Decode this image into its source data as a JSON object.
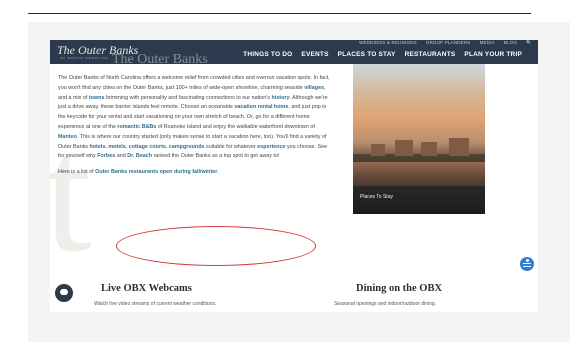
{
  "header": {
    "logo_text": "The Outer Banks",
    "logo_tagline": "OF NORTH CAROLINA",
    "utility_links": [
      "WEDDINGS & REUNIONS",
      "GROUP PLANNERS",
      "MEDIA",
      "BLOG",
      "🔍"
    ],
    "nav_items": [
      "THINGS TO DO",
      "EVENTS",
      "PLACES TO STAY",
      "RESTAURANTS",
      "PLAN YOUR TRIP"
    ]
  },
  "faded_heading": "The Outer Banks",
  "intro": {
    "p1": [
      {
        "t": "The Outer Banks of North Carolina offers a welcome relief from crowded cities and overrun vacation spots. In fact, you won't find any cities on the Outer Banks, just 100+ miles of wide-open shoreline, charming seaside "
      },
      {
        "t": "villages",
        "link": true
      },
      {
        "t": ", and a mix of "
      },
      {
        "t": "towns",
        "link": true
      },
      {
        "t": " brimming with personality and fascinating connections to our nation's "
      },
      {
        "t": "history",
        "link": true
      },
      {
        "t": ". Although we're just a drive away, these barrier islands feel remote. Choose an oceanside "
      },
      {
        "t": "vacation rental home",
        "link": true
      },
      {
        "t": ", and just pop in the keycode for your rental and start vacationing on your own stretch of beach. Or, go for a different home experience at one of the "
      },
      {
        "t": "romantic B&Bs",
        "link": true
      },
      {
        "t": " of Roanoke Island and enjoy the walkable waterfront downtown of "
      },
      {
        "t": "Manteo",
        "link": true
      },
      {
        "t": ". This is where our country started (only makes sense to start a vacation here, too). You'll find a variety of Outer Banks "
      },
      {
        "t": "hotels",
        "link": true
      },
      {
        "t": ", "
      },
      {
        "t": "motels",
        "link": true
      },
      {
        "t": ", "
      },
      {
        "t": "cottage courts",
        "link": true
      },
      {
        "t": ", "
      },
      {
        "t": "campgrounds",
        "link": true
      },
      {
        "t": " suitable for whatever "
      },
      {
        "t": "experience",
        "link": true
      },
      {
        "t": " you choose. See for yourself why "
      },
      {
        "t": "Forbes",
        "link": true
      },
      {
        "t": " and "
      },
      {
        "t": "Dr. Beach",
        "link": true
      },
      {
        "t": " ranked the Outer Banks as a top spot to get away to!"
      }
    ],
    "p2_prefix": "Here is a list of ",
    "p2_link": "Outer Banks restaurants open during fall/winter",
    "p2_suffix": "."
  },
  "photo_caption": "Places To Stay",
  "cards": [
    {
      "title": "Live OBX Webcams",
      "subtitle": "Watch live video streams of current weather conditions."
    },
    {
      "title": "Dining on the OBX",
      "subtitle": "Seasonal openings and indoor/outdoor dining."
    }
  ],
  "colors": {
    "nav_bg": "#2b3a4c",
    "link": "#2f6f8f",
    "annotation": "#d23a3a",
    "accessibility": "#2a7fd1"
  },
  "icons": {
    "accessibility": "accessibility-icon",
    "chat": "chat-icon",
    "search": "search-icon"
  }
}
